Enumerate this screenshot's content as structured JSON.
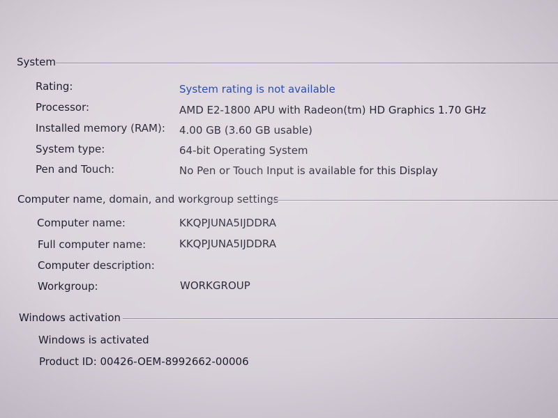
{
  "system": {
    "heading": "System",
    "rows": [
      {
        "label": "Rating:",
        "value": "System rating is not available"
      },
      {
        "label": "Processor:",
        "value": "AMD E2-1800 APU with Radeon(tm) HD Graphics  1.70 GHz"
      },
      {
        "label": "Installed memory (RAM):",
        "value": "4.00 GB (3.60 GB usable)"
      },
      {
        "label": "System type:",
        "value": "64-bit Operating System"
      },
      {
        "label": "Pen and Touch:",
        "value": "No Pen or Touch Input is available for this Display"
      }
    ]
  },
  "computer": {
    "heading": "Computer name, domain, and workgroup settings",
    "rows": [
      {
        "label": "Computer name:",
        "value": "KKQPJUNA5IJDDRA"
      },
      {
        "label": "Full computer name:",
        "value": "KKQPJUNA5IJDDRA"
      },
      {
        "label": "Computer description:",
        "value": ""
      },
      {
        "label": "Workgroup:",
        "value": "WORKGROUP"
      }
    ]
  },
  "activation": {
    "heading": "Windows activation",
    "status": "Windows is activated",
    "product_id": "Product ID: 00426-OEM-8992662-00006"
  },
  "colors": {
    "link": "#1a3fa8",
    "text": "#1e1c2c",
    "background": "#dcd4dc"
  }
}
